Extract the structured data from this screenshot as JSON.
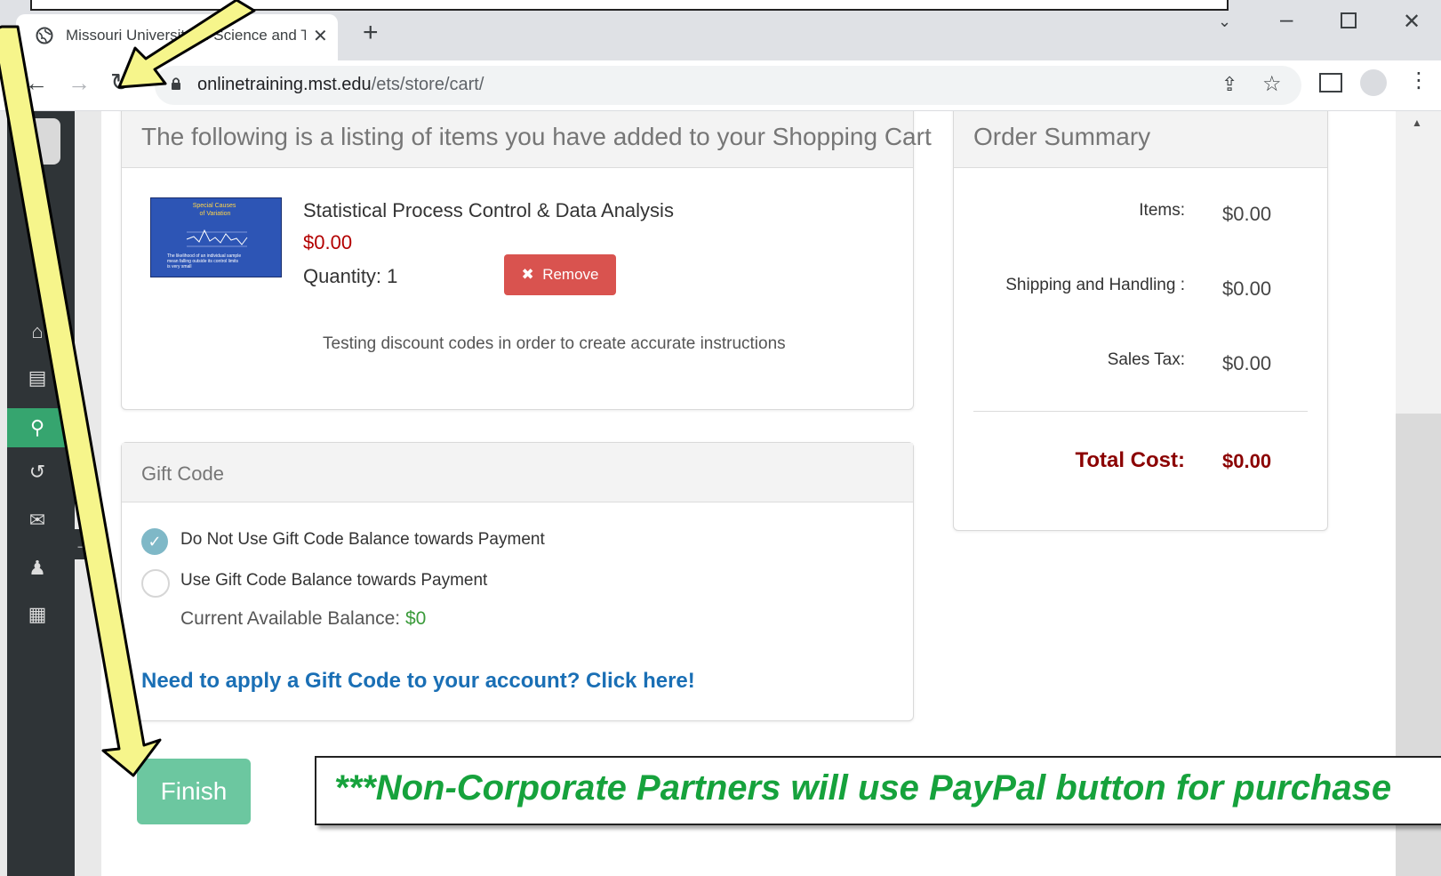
{
  "browser": {
    "tab_title": "Missouri University of Science and Technology",
    "url_host": "onlinetraining.mst.edu",
    "url_path": "/ets/store/cart/"
  },
  "cart": {
    "heading": "The following is a listing of items you have added to your Shopping Cart",
    "item": {
      "name": "Statistical Process Control & Data Analysis",
      "price": "$0.00",
      "quantity_label": "Quantity:",
      "quantity": "1",
      "remove_label": "Remove",
      "note": "Testing discount codes in order to create accurate instructions",
      "thumbnail_text": {
        "title": "Special Causes of Variation",
        "caption": "The likelihood of an individual sample mean falling outside its control limits is very small"
      }
    }
  },
  "gift_code": {
    "heading": "Gift Code",
    "options": [
      {
        "label": "Do Not Use Gift Code Balance towards Payment",
        "selected": true
      },
      {
        "label": "Use Gift Code Balance towards Payment",
        "selected": false
      }
    ],
    "balance_label": "Current Available Balance:",
    "balance_value": "$0",
    "apply_link": "Need to apply a Gift Code to your account? Click here!"
  },
  "summary": {
    "heading": "Order Summary",
    "items_label": "Items:",
    "items_value": "$0.00",
    "shipping_label": "Shipping and Handling :",
    "shipping_value": "$0.00",
    "tax_label": "Sales Tax:",
    "tax_value": "$0.00",
    "total_label": "Total Cost:",
    "total_value": "$0.00"
  },
  "actions": {
    "finish_label": "Finish"
  },
  "annotation": {
    "callout": "***Non-Corporate Partners will use PayPal button for purchase"
  },
  "colors": {
    "accent_green": "#16a23c",
    "remove_red": "#d9534f",
    "finish_green": "#6cc7a0",
    "price_red": "#b30000",
    "link_blue": "#1a6fb5",
    "arrow_yellow": "#f6f58b"
  },
  "icons": {
    "tab": "globe-icon",
    "reload": "reload-icon",
    "remove": "times-icon",
    "nav": [
      "home-icon",
      "book-icon",
      "search-icon",
      "history-icon",
      "chat-icon",
      "user-icon",
      "calendar-icon"
    ]
  }
}
